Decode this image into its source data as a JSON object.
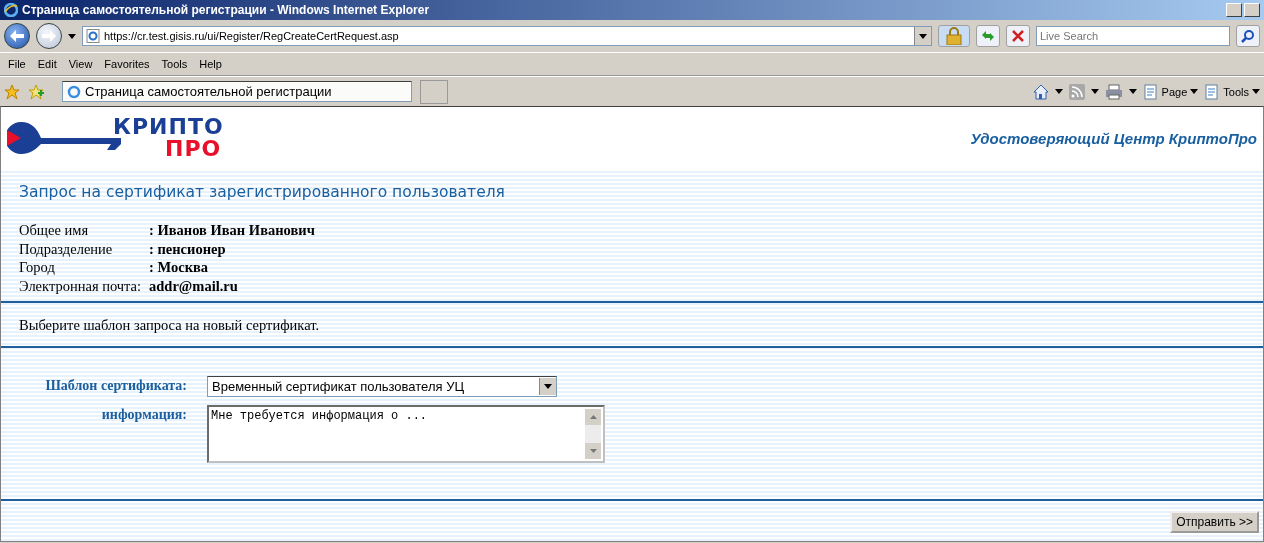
{
  "window": {
    "title": "Страница самостоятельной регистрации - Windows Internet Explorer"
  },
  "address_bar": {
    "url": "https://cr.test.gisis.ru/ui/Register/RegCreateCertRequest.asp",
    "search_placeholder": "Live Search"
  },
  "menu": [
    "File",
    "Edit",
    "View",
    "Favorites",
    "Tools",
    "Help"
  ],
  "tabs": [
    {
      "label": "Страница самостоятельной регистрации",
      "selected": true
    }
  ],
  "command_bar": [
    "Page",
    "Tools"
  ],
  "page": {
    "logo": {
      "top": "КРИПТО",
      "bottom": "ПРО"
    },
    "tagline": "Удостоверяющий Центр КриптоПро",
    "heading": "Запрос на сертификат зарегистрированного пользователя",
    "fields": [
      {
        "label": "Общее имя",
        "value": ": Иванов Иван Иванович"
      },
      {
        "label": "Подразделение",
        "value": ": пенсионер"
      },
      {
        "label": "Город",
        "value": ": Москва"
      },
      {
        "label": "Электронная почта:",
        "value": "addr@mail.ru"
      }
    ],
    "instruction": "Выберите шаблон запроса на новый сертификат.",
    "form": {
      "template_label": "Шаблон сертификата:",
      "template_value": "Временный сертификат пользователя УЦ",
      "info_label": "информация:",
      "info_value": "Мне требуется информация о ..."
    },
    "submit": "Отправить >>"
  }
}
